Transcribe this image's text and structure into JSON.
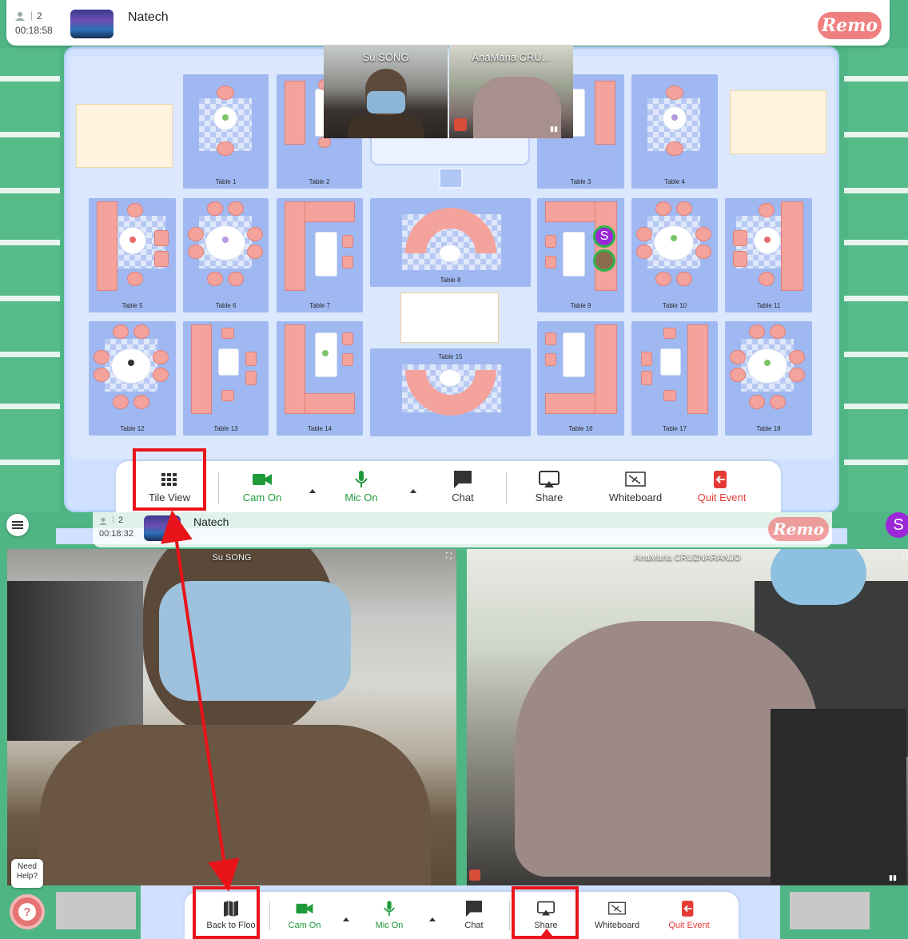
{
  "upper": {
    "participants": "2",
    "timer": "00:18:58",
    "event_name": "Natech",
    "brand": "Remo",
    "video_tiles": [
      {
        "name": "Su SONG"
      },
      {
        "name": "AnaMaria CRU..."
      }
    ],
    "tables": [
      "Table 1",
      "Table 2",
      "Table 3",
      "Table 4",
      "Table 5",
      "Table 6",
      "Table 7",
      "Table 8",
      "Table 9",
      "Table 10",
      "Table 11",
      "Table 12",
      "Table 13",
      "Table 14",
      "Table 15",
      "Table 16",
      "Table 17",
      "Table 18"
    ],
    "avatar_initial": "S",
    "toolbar": {
      "tile_view": "Tile View",
      "cam_on": "Cam On",
      "mic_on": "Mic On",
      "chat": "Chat",
      "share": "Share",
      "whiteboard": "Whiteboard",
      "quit": "Quit Event"
    }
  },
  "lower": {
    "participants": "2",
    "timer": "00:18:32",
    "event_name": "Natech",
    "brand": "Remo",
    "user_initial": "S",
    "cams": [
      {
        "name": "Su SONG"
      },
      {
        "name": "AnaMaria CRUZNARANJO"
      }
    ],
    "help": "Need Help?",
    "toolbar": {
      "back_to_floor": "Back to Floo",
      "cam_on": "Cam On",
      "mic_on": "Mic On",
      "chat": "Chat",
      "share": "Share",
      "whiteboard": "Whiteboard",
      "quit": "Quit Event"
    }
  },
  "colors": {
    "floor_green": "#4fb584",
    "table_blue": "#9fb8f2",
    "sofa_pink": "#f4a39c",
    "accent_green": "#1f9a3a",
    "quit_red": "#e53935",
    "annotation_red": "#e8141a",
    "remo_pink": "#f08080",
    "avatar_purple": "#9b27d8"
  }
}
